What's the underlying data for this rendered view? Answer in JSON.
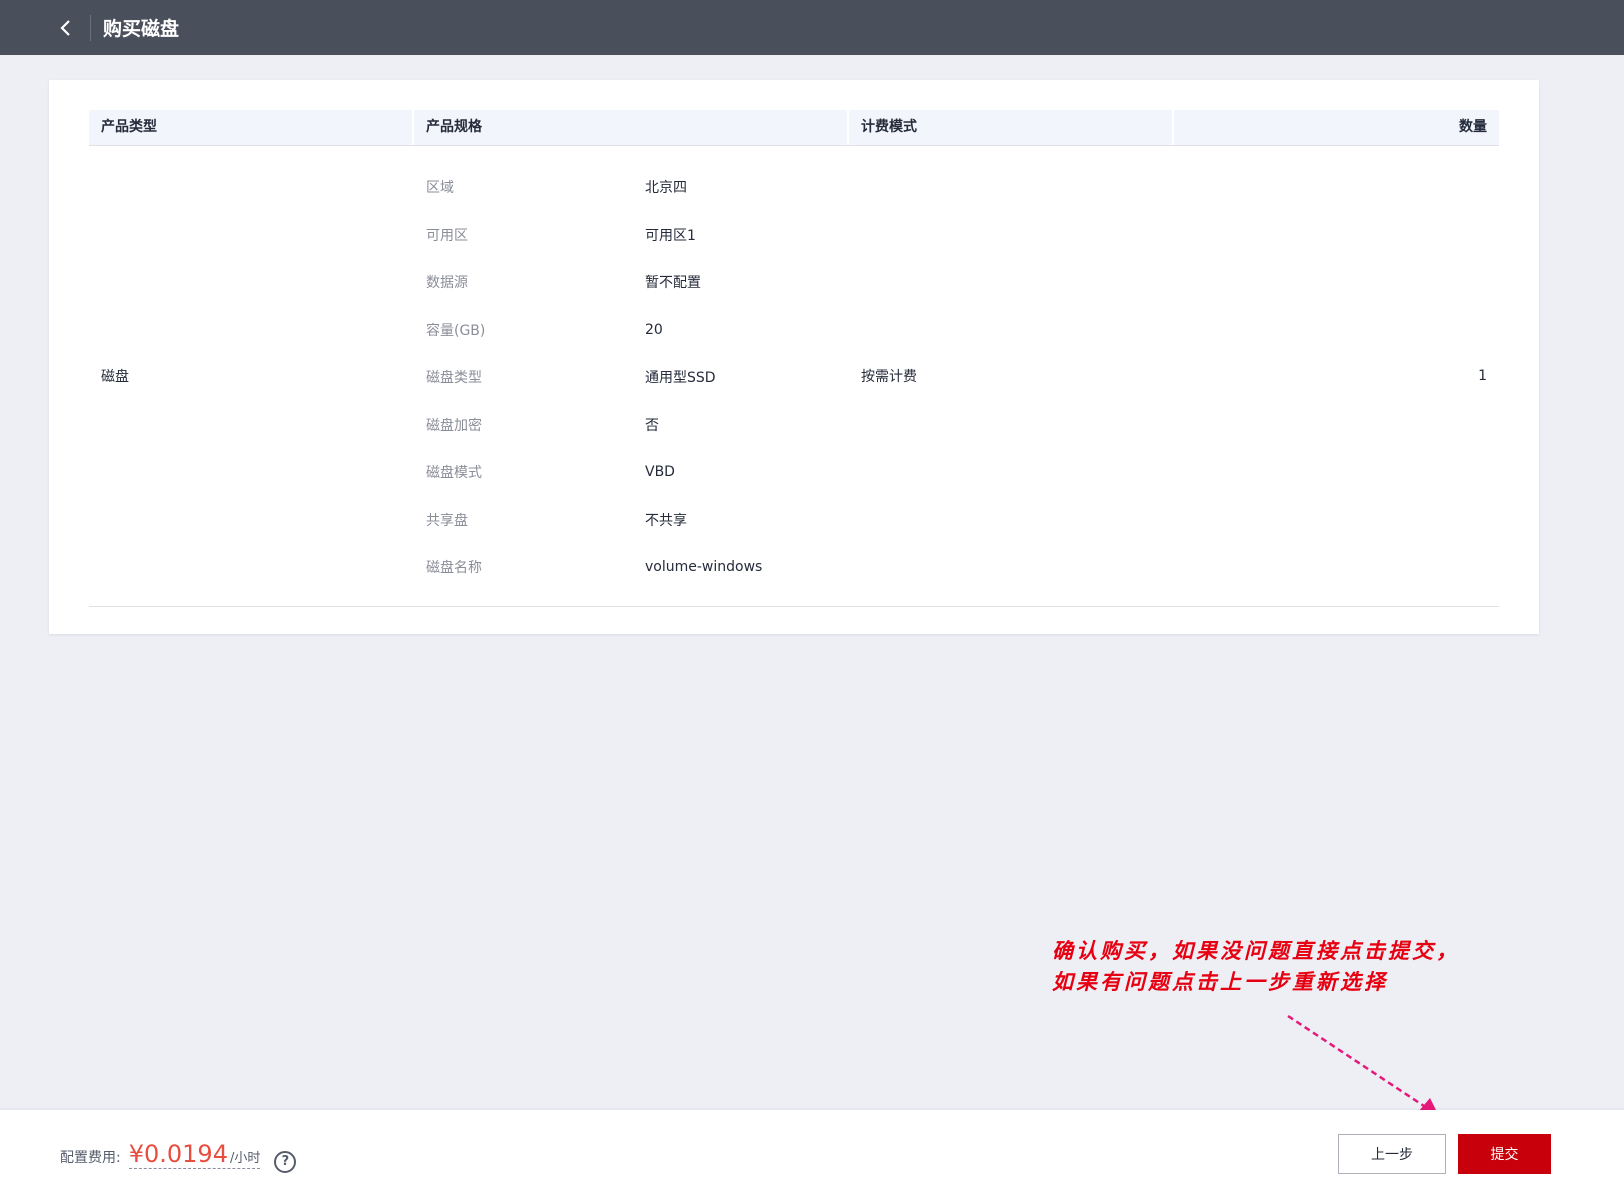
{
  "header": {
    "title": "购买磁盘",
    "back_icon": "chevron-left-icon"
  },
  "table": {
    "headers": [
      "产品类型",
      "产品规格",
      "计费模式",
      "数量"
    ],
    "row": {
      "product_type": "磁盘",
      "specs": [
        {
          "key": "区域",
          "value": "北京四"
        },
        {
          "key": "可用区",
          "value": "可用区1"
        },
        {
          "key": "数据源",
          "value": "暂不配置"
        },
        {
          "key": "容量(GB)",
          "value": "20"
        },
        {
          "key": "磁盘类型",
          "value": "通用型SSD"
        },
        {
          "key": "磁盘加密",
          "value": "否"
        },
        {
          "key": "磁盘模式",
          "value": "VBD"
        },
        {
          "key": "共享盘",
          "value": "不共享"
        },
        {
          "key": "磁盘名称",
          "value": "volume-windows"
        }
      ],
      "billing_mode": "按需计费",
      "quantity": "1"
    }
  },
  "footer": {
    "fee_label": "配置费用:",
    "fee_price": "¥0.0194",
    "fee_unit": "/小时",
    "help_icon": "question-circle-icon",
    "prev_label": "上一步",
    "submit_label": "提交"
  },
  "annotation": {
    "line1": "确认购买，如果没问题直接点击提交，",
    "line2": "如果有问题点击上一步重新选择"
  },
  "colors": {
    "topbar": "#4a4f5c",
    "submit": "#c7000b",
    "price": "#e84e40",
    "annotation": "#e60012",
    "arrow": "#e6197a"
  }
}
